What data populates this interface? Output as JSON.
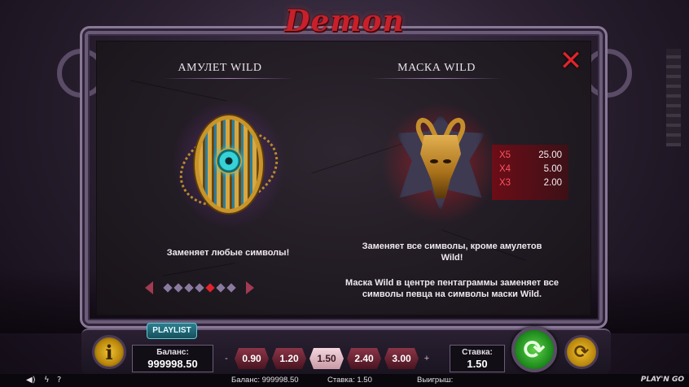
{
  "logo": {
    "text": "Demon"
  },
  "close": {
    "icon": "close-icon",
    "glyph": "✕"
  },
  "features": {
    "amulet": {
      "title": "АМУЛЕТ WILD",
      "description": "Заменяет любые символы!"
    },
    "mask": {
      "title": "МАСКА WILD",
      "description1": "Заменяет все символы, кроме амулетов Wild!",
      "description2": "Маска Wild в центре пентаграммы заменяет все символы певца на символы маски Wild.",
      "paytable": [
        {
          "mult": "X5",
          "value": "25.00"
        },
        {
          "mult": "X4",
          "value": "5.00"
        },
        {
          "mult": "X3",
          "value": "2.00"
        }
      ]
    }
  },
  "pager": {
    "pages": 7,
    "active_index": 4
  },
  "controls": {
    "playlist_label": "PLAYLIST",
    "balance_label": "Баланс:",
    "balance_value": "999998.50",
    "bet_label": "Ставка:",
    "bet_value": "1.50",
    "bet_minus": "-",
    "bet_plus": "+",
    "bet_options": [
      "0.90",
      "1.20",
      "1.50",
      "2.40",
      "3.00"
    ],
    "selected_bet_index": 2,
    "info_glyph": "i"
  },
  "status_bar": {
    "balance": "Баланс: 999998.50",
    "bet": "Ставка: 1.50",
    "win": "Выигрыш:",
    "brand": "PLAY'N GO",
    "icons": [
      "speaker-icon",
      "lightning-icon",
      "help-icon"
    ]
  },
  "colors": {
    "accent_red": "#e0242c",
    "spin_green": "#1d8a1c",
    "gold": "#d9a840",
    "frame": "#6b5b78"
  }
}
